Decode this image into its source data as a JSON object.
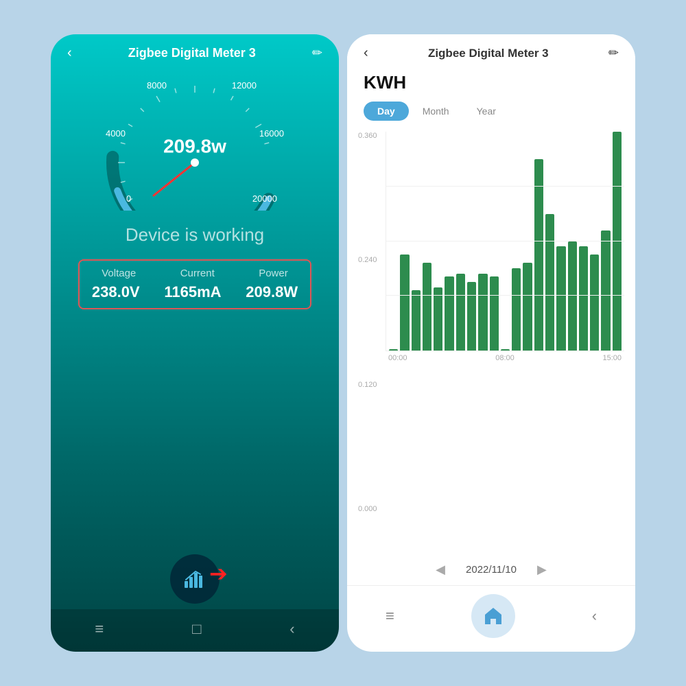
{
  "left_phone": {
    "title": "Zigbee Digital Meter 3",
    "gauge": {
      "value": "209.8w",
      "labels": {
        "top_left": "8000",
        "top_right": "12000",
        "mid_left": "4000",
        "mid_right": "16000",
        "bottom_left": "0",
        "bottom_right": "20000"
      }
    },
    "status": "Device is working",
    "stats": {
      "voltage_label": "Voltage",
      "current_label": "Current",
      "power_label": "Power",
      "voltage_value": "238.0V",
      "current_value": "1165mA",
      "power_value": "209.8W"
    },
    "nav": {
      "menu": "≡",
      "home": "□",
      "back": "‹"
    }
  },
  "right_phone": {
    "title": "Zigbee Digital Meter 3",
    "kwh_label": "KWH",
    "tabs": [
      "Day",
      "Month",
      "Year"
    ],
    "active_tab": "Day",
    "chart": {
      "y_labels": [
        "0.360",
        "0.240",
        "0.120",
        "0.000"
      ],
      "x_labels": [
        "00:00",
        "08:00",
        "15:00"
      ],
      "bars": [
        0,
        35,
        22,
        32,
        23,
        27,
        28,
        25,
        28,
        27,
        0,
        30,
        32,
        70,
        50,
        38,
        40,
        38,
        35,
        44,
        80
      ]
    },
    "date": "2022/11/10",
    "nav": {
      "menu": "≡",
      "home": "□",
      "back": "‹"
    }
  }
}
